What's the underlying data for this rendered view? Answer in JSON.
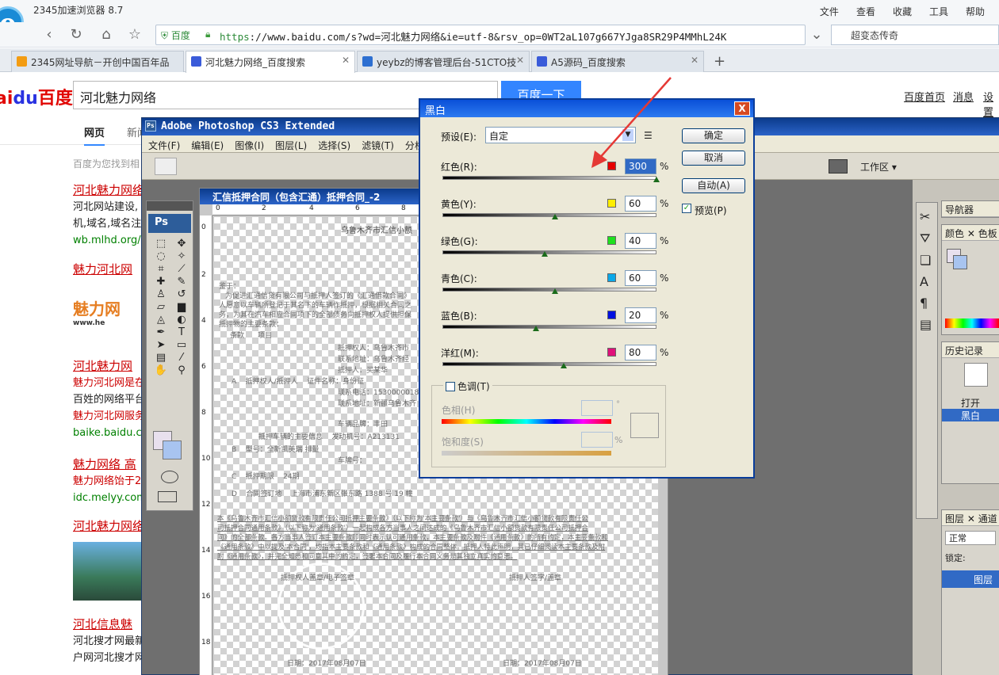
{
  "browser": {
    "title": "2345加速浏览器 8.7",
    "menus": [
      "文件",
      "查看",
      "收藏",
      "工具",
      "帮助"
    ],
    "safe_label": "百度",
    "url_https": "https",
    "url_rest": "://www.baidu.com/s?wd=河北魅力网络&ie=utf-8&rsv_op=0WT2aL107g667YJga8SR29P4MMhL24K",
    "search_text": "超变态传奇",
    "tabs": [
      {
        "label": "2345网址导航－开创中国百年品"
      },
      {
        "label": "河北魅力网络_百度搜索"
      },
      {
        "label": "yeybz的博客管理后台-51CTO技"
      },
      {
        "label": "A5源码_百度搜索"
      }
    ],
    "new_tab": "+"
  },
  "baidu": {
    "logo_a": "ai",
    "logo_b": "du",
    "logo_c": "百度",
    "query": "河北魅力网络",
    "button": "百度一下",
    "links": [
      "百度首页",
      "消息",
      "设置"
    ],
    "tabs": [
      "网页",
      "新闻"
    ],
    "found": "百度为您找到相",
    "results": [
      {
        "title": "河北魅力网络",
        "line1": "河北网站建设,",
        "line2": "机,域名,域名注",
        "url": "wb.mlhd.org/"
      },
      {
        "title": "魅力河北网"
      },
      {
        "title": "河北魅力网",
        "line1": "魅力河北网是在",
        "line2": "百姓的网络平台",
        "line3": "魅力河北网服务",
        "url": "baike.baidu.com"
      },
      {
        "title": "魅力网络 高",
        "line1": "魅力网络饴于2",
        "url": "idc.melyy.com"
      },
      {
        "title": "河北魅力网络"
      },
      {
        "title": "河北信息魅",
        "line1": "河北搜才网最新",
        "line2": "户网河北搜才网"
      }
    ],
    "banner_text": "魅力网",
    "banner_url": "www.he"
  },
  "photoshop": {
    "title": "Adobe Photoshop CS3 Extended",
    "menu": [
      "文件(F)",
      "编辑(E)",
      "图像(I)",
      "图层(L)",
      "选择(S)",
      "滤镜(T)",
      "分析"
    ],
    "workspace": "工作区 ▾",
    "doc_title": "汇信抵押合同（包含汇通）抵押合同_-2",
    "ruler_h": [
      "0",
      "2",
      "4",
      "6",
      "8"
    ],
    "ruler_v": [
      "0",
      "2",
      "4",
      "6",
      "8",
      "10",
      "12",
      "14",
      "16",
      "18"
    ],
    "panels": {
      "nav": "导航器",
      "color": "颜色",
      "swatches": "色板",
      "history": "历史记录",
      "history_items": [
        "打开",
        "黑白"
      ],
      "layers": "图层",
      "channels": "通道",
      "blend": "正常",
      "lock": "锁定:",
      "layer_name": "图层"
    },
    "doc_lines": [
      "乌鲁木齐市汇信小额",
      "鉴于：",
      "为促进汇通信贷有限公司与抵押人签订的《汇通借款合同》",
      "人愿意以车辆所登记于其名下的车辆作抵押，根据相关合同之",
      "务，为其在汽车相应合同项下的全部债务向抵押权人提供担保",
      "抵押物的主要条款：",
      "条款      项目",
      "抵押权人：乌鲁木齐市",
      "联系地址：乌鲁木齐经",
      "抵押人：买某华",
      "A    抵押权人/抵押人    证件名称：身份证",
      "联系电话：15300000188",
      "联系地址：新疆乌鲁木齐",
      "车辆品牌：丰田",
      "抵押车辆的主要信息    发动机号：A213131",
      "B    型号：全新凯美瑞 排量",
      "车牌号：",
      "C    抵押期限    24期",
      "D    合同签订地    上海市浦东新区张东路 1388 号 19 幢",
      "本《乌鲁木齐市汇信小额贷款有限责任公司抵押主要条款》（以下称为'本主要条款'）与《乌鲁木齐市汇信小额贷款有限责任公",
      "司抵押合同通用条款》（以下称为'通用条款'）一起构成各方当事人之间达成的《乌鲁木齐市汇信小额贷款有限责任公司抵押合",
      "同》的全部条款。各方当事人签订本主要条款即同时表示认可通用条款，本主要条款及附件《通用条款》的所有约定，本主要条款和",
      "《通用条款》中以提及'本合同'，均指本主要条款和《通用条款》构成的合同整体。抵押人特此声明，其已仔细阅读本主要条款及附",
      "附《通用条款》，并完全知悉和同意其中的约定，签署本合同及履行本合同义务是其独立真实的意思。",
      "抵押权人盖章/电子签章",
      "抵押人签字/盖章",
      "日期：2017年08月07日",
      "日期：2017年08月07日"
    ]
  },
  "bw_dialog": {
    "title": "黑白",
    "close": "X",
    "preset_label": "预设(E):",
    "preset_value": "自定",
    "buttons": {
      "ok": "确定",
      "cancel": "取消",
      "auto": "自动(A)"
    },
    "preview": "预览(P)",
    "preview_check": "✓",
    "channels": [
      {
        "label": "红色(R):",
        "value": "300",
        "color": "#e60000",
        "level": 1.0
      },
      {
        "label": "黄色(Y):",
        "value": "60",
        "color": "#ffee00",
        "level": 0.52
      },
      {
        "label": "绿色(G):",
        "value": "40",
        "color": "#1ee01e",
        "level": 0.47
      },
      {
        "label": "青色(C):",
        "value": "60",
        "color": "#0aa8e8",
        "level": 0.52
      },
      {
        "label": "蓝色(B):",
        "value": "20",
        "color": "#0010e0",
        "level": 0.43
      },
      {
        "label": "洋红(M):",
        "value": "80",
        "color": "#e0107a",
        "level": 0.56
      }
    ],
    "percent": "%",
    "tint_label": "色调(T)",
    "hue_label": "色相(H)",
    "degree": "°",
    "sat_label": "饱和度(S)",
    "sat_pct": "%"
  },
  "colors": {
    "accent": "#3385ff",
    "baidu_red": "#e10602",
    "baidu_blue": "#2932e1",
    "result_red": "#cc0000",
    "url_green": "#008000",
    "arrow": "#e53935"
  }
}
